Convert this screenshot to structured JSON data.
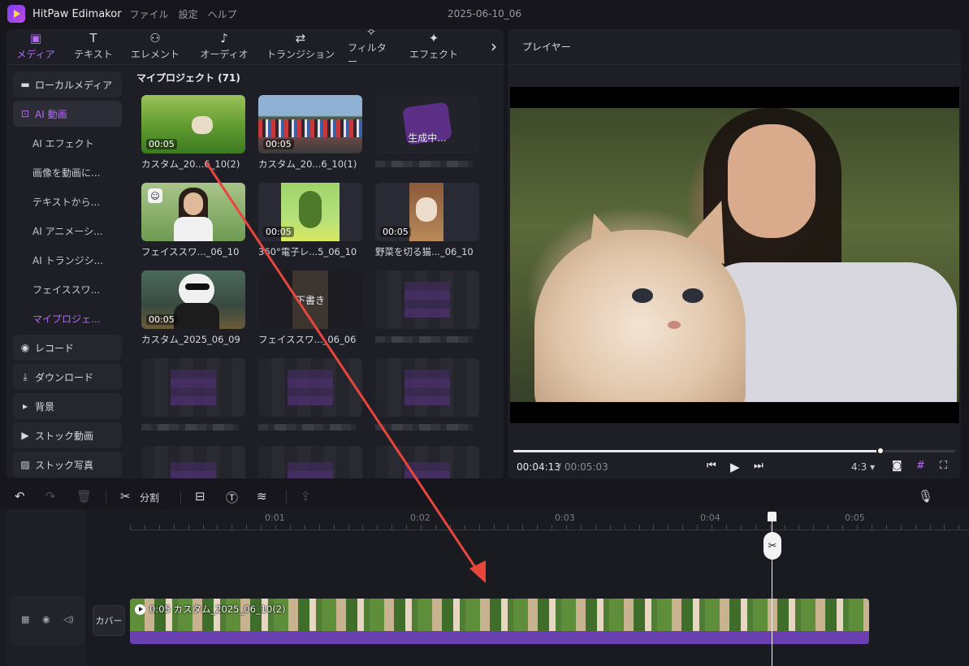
{
  "app": {
    "name": "HitPaw Edimakor",
    "menus": [
      "ファイル",
      "設定",
      "ヘルプ"
    ],
    "project_title": "2025-06-10_06"
  },
  "toolbar_tabs": [
    {
      "label": "メディア",
      "icon": "media-icon",
      "active": true
    },
    {
      "label": "テキスト",
      "icon": "text-icon"
    },
    {
      "label": "エレメント",
      "icon": "element-icon"
    },
    {
      "label": "オーディオ",
      "icon": "audio-icon"
    },
    {
      "label": "トランジション",
      "icon": "transition-icon"
    },
    {
      "label": "フィルター",
      "icon": "filter-icon"
    },
    {
      "label": "エフェクト",
      "icon": "effect-icon"
    }
  ],
  "sidebar": {
    "items": [
      {
        "label": "ローカルメディア",
        "icon": "folder-icon"
      },
      {
        "label": "AI 動画",
        "icon": "ai-video-icon",
        "active": true
      },
      {
        "label": "AI エフェクト",
        "sub": true
      },
      {
        "label": "画像を動画に...",
        "sub": true
      },
      {
        "label": "テキストから...",
        "sub": true
      },
      {
        "label": "AI アニメーシ...",
        "sub": true
      },
      {
        "label": "AI トランジシ...",
        "sub": true
      },
      {
        "label": "フェイススワ...",
        "sub": true
      },
      {
        "label": "マイプロジェ...",
        "sub": true,
        "active": true
      },
      {
        "label": "レコード",
        "icon": "record-icon"
      },
      {
        "label": "ダウンロード",
        "icon": "download-icon"
      },
      {
        "label": "背景",
        "icon": "caret-right-icon"
      },
      {
        "label": "ストック動画",
        "icon": "stock-video-icon"
      },
      {
        "label": "ストック写真",
        "icon": "stock-photo-icon"
      }
    ]
  },
  "media": {
    "heading": "マイプロジェクト (71)",
    "cards": [
      {
        "label": "カスタム_20...6_10(2)",
        "duration": "00:05",
        "kind": "grass-cat"
      },
      {
        "label": "カスタム_20...6_10(1)",
        "duration": "00:05",
        "kind": "clothes"
      },
      {
        "label": "",
        "status": "生成中...",
        "kind": "generating"
      },
      {
        "label": "フェイススワ..._06_10",
        "kind": "girl",
        "badge": "face-swap-icon"
      },
      {
        "label": "360°電子レ...5_06_10",
        "duration": "00:05",
        "kind": "avocado"
      },
      {
        "label": "野菜を切る猫..._06_10",
        "duration": "00:05",
        "kind": "chef-cat"
      },
      {
        "label": "カスタム_2025_06_09",
        "duration": "00:05",
        "kind": "panda"
      },
      {
        "label": "フェイススワ..._06_06",
        "status": "下書き",
        "kind": "draft"
      },
      {
        "label": "",
        "kind": "pixelated"
      },
      {
        "label": "",
        "kind": "pixelated"
      },
      {
        "label": "",
        "kind": "pixelated"
      },
      {
        "label": "",
        "kind": "pixelated"
      }
    ]
  },
  "player": {
    "title": "プレイヤー",
    "current_time": "00:04:13",
    "total_time": "/ 00:05:03",
    "progress": 0.83,
    "ratio": "4:3"
  },
  "edit_toolbar": {
    "split_label": "分割"
  },
  "timeline": {
    "ticks": [
      "0:01",
      "0:02",
      "0:03",
      "0:04",
      "0:05"
    ],
    "cover_label": "カバー",
    "clip_label": "0:05 カスタム_2025_06_10(2)"
  },
  "colors": {
    "accent": "#b46cf6",
    "clip": "#6a3fb0",
    "arrow": "#e8453c"
  }
}
